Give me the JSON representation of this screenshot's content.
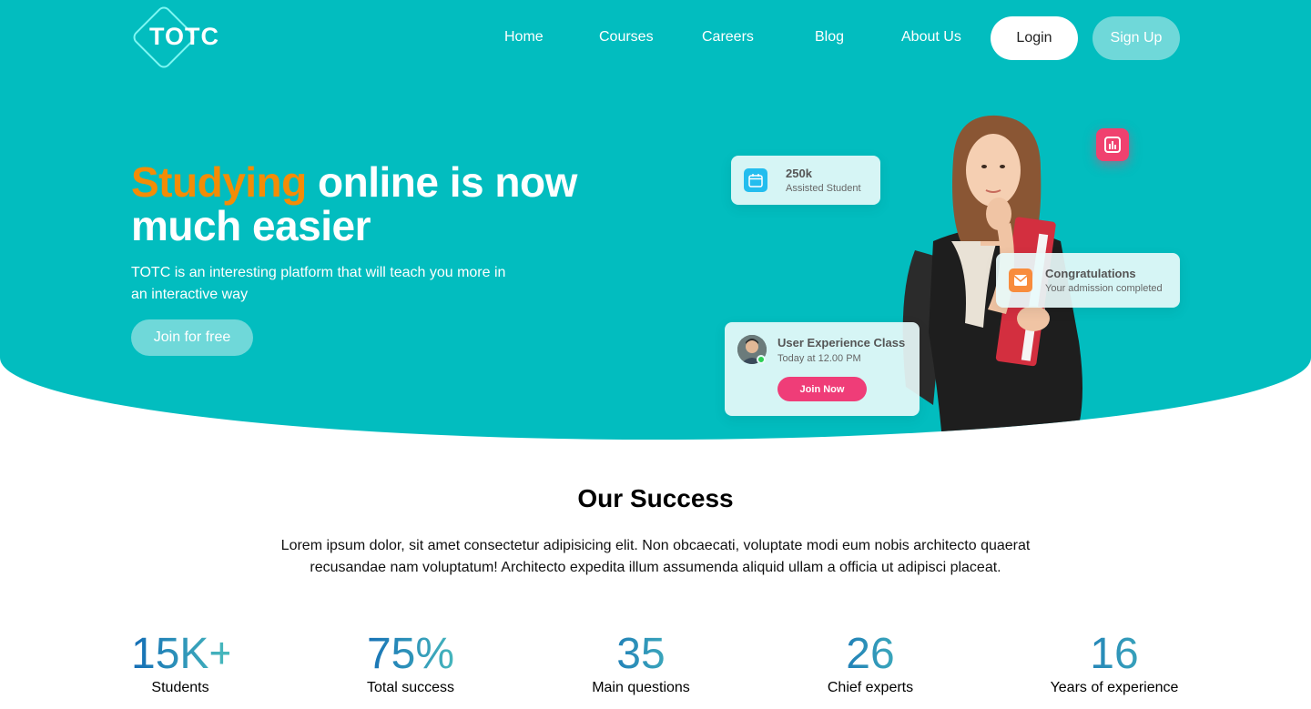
{
  "brand": {
    "name": "TOTC"
  },
  "nav": {
    "links": [
      "Home",
      "Courses",
      "Careers",
      "Blog",
      "About Us"
    ],
    "login_label": "Login",
    "signup_label": "Sign Up"
  },
  "hero": {
    "title_accent": "Studying",
    "title_rest": " online is now much easier",
    "subtitle": "TOTC is an interesting platform that will teach you more in an interactive way",
    "cta_label": "Join for free",
    "cards": {
      "assisted": {
        "title": "250k",
        "text": "Assisted Student",
        "icon": "calendar-icon"
      },
      "congrats": {
        "title": "Congratulations",
        "text": "Your admission completed",
        "icon": "mail-icon"
      },
      "class": {
        "title": "User Experience Class",
        "text": "Today at 12.00 PM",
        "button": "Join Now",
        "icon": "avatar"
      }
    }
  },
  "success": {
    "title": "Our Success",
    "description": "Lorem ipsum dolor, sit amet consectetur adipisicing elit. Non obcaecati, voluptate modi eum nobis architecto quaerat recusandae nam voluptatum! Architecto expedita illum assumenda aliquid ullam a officia ut adipisci placeat.",
    "stats": [
      {
        "value": "15K+",
        "label": "Students"
      },
      {
        "value": "75%",
        "label": "Total success"
      },
      {
        "value": "35",
        "label": "Main questions"
      },
      {
        "value": "26",
        "label": "Chief experts"
      },
      {
        "value": "16",
        "label": "Years of experience"
      }
    ]
  },
  "colors": {
    "primary": "#02bdbf",
    "accent": "#f48c06",
    "pink": "#ef3d78",
    "gradient_start": "#136cb5",
    "gradient_end": "#49bbbd"
  }
}
